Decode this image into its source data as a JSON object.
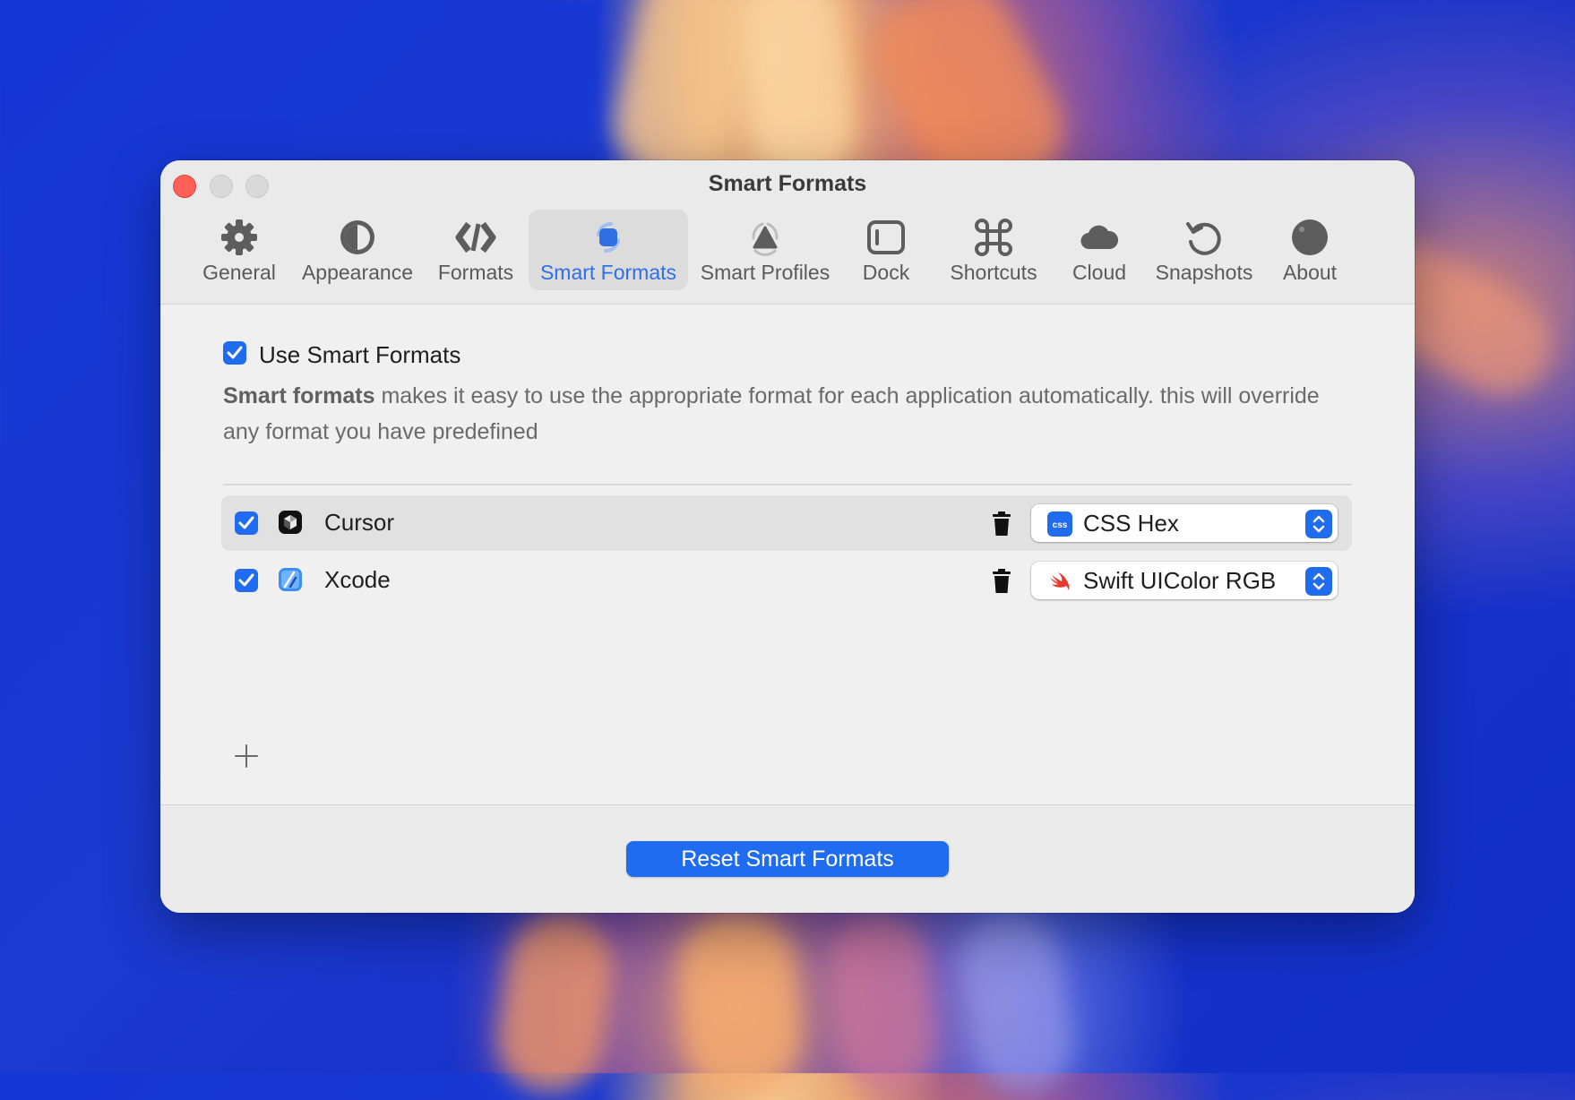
{
  "window": {
    "title": "Smart Formats"
  },
  "tabs": [
    {
      "label": "General",
      "icon": "gear-icon"
    },
    {
      "label": "Appearance",
      "icon": "appearance-icon"
    },
    {
      "label": "Formats",
      "icon": "formats-icon"
    },
    {
      "label": "Smart Formats",
      "icon": "smart-formats-icon",
      "active": true
    },
    {
      "label": "Smart Profiles",
      "icon": "smart-profiles-icon"
    },
    {
      "label": "Dock",
      "icon": "dock-icon"
    },
    {
      "label": "Shortcuts",
      "icon": "command-icon"
    },
    {
      "label": "Cloud",
      "icon": "cloud-icon"
    },
    {
      "label": "Snapshots",
      "icon": "snapshots-icon"
    },
    {
      "label": "About",
      "icon": "about-icon"
    }
  ],
  "settings": {
    "use_smart_formats_label": "Use Smart Formats",
    "use_smart_formats_checked": true,
    "description_bold": "Smart formats",
    "description_rest": " makes it easy to use the appropriate format for each application automatically. this will override any format you have predefined"
  },
  "apps": [
    {
      "name": "Cursor",
      "enabled": true,
      "format": "CSS Hex",
      "app_icon": "cursor-app-icon",
      "format_icon": "css-icon"
    },
    {
      "name": "Xcode",
      "enabled": true,
      "format": "Swift UIColor RGB",
      "app_icon": "xcode-app-icon",
      "format_icon": "swift-icon"
    }
  ],
  "footer": {
    "reset_label": "Reset Smart Formats"
  },
  "colors": {
    "accent": "#1f6cf0",
    "active_tab_text": "#2f6fe6",
    "close": "#fe5f57"
  }
}
